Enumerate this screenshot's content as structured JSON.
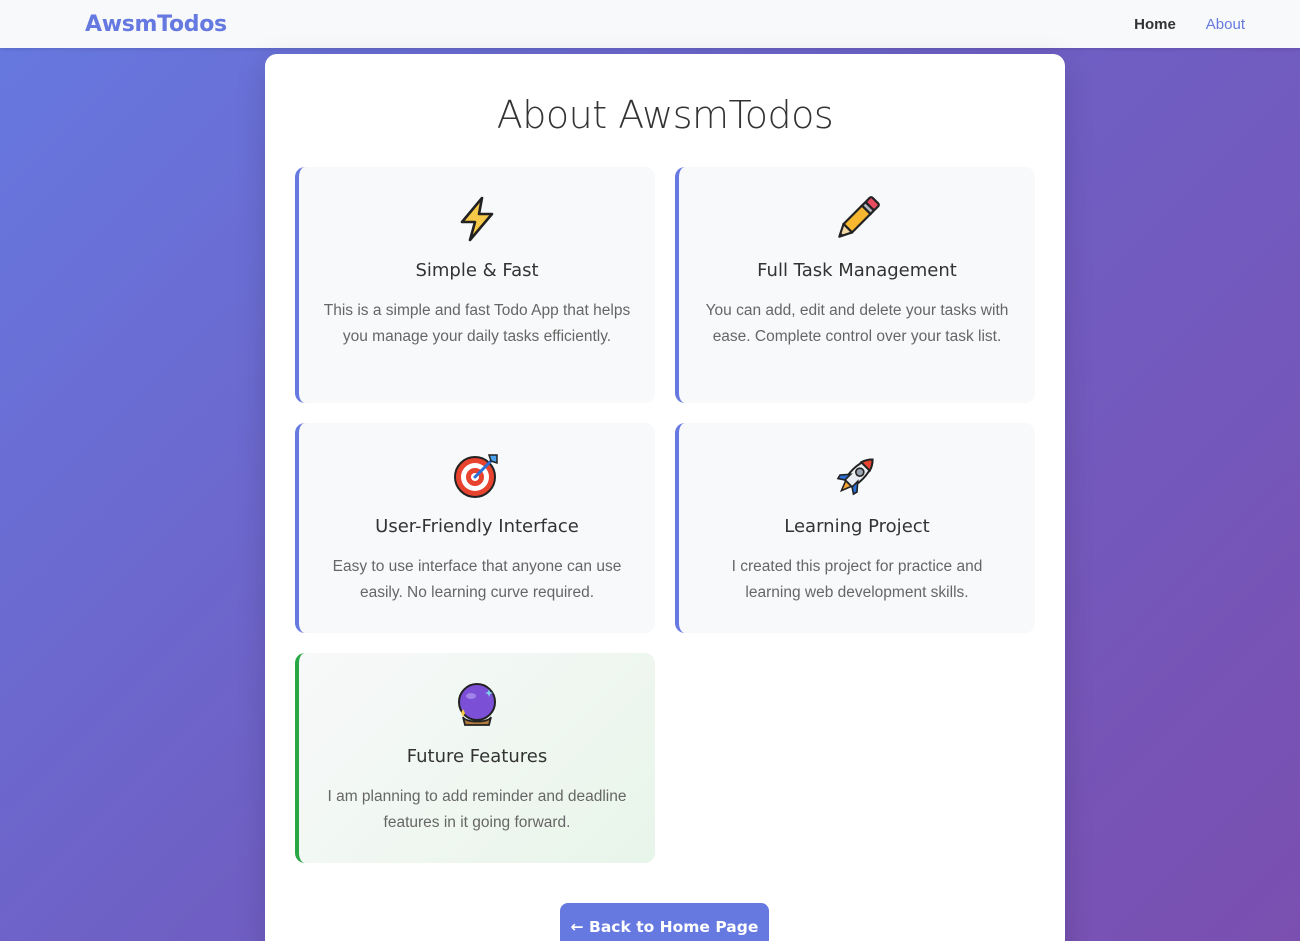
{
  "nav": {
    "brand": "AwsmTodos",
    "links": [
      "Home",
      "About"
    ],
    "active": "About"
  },
  "page": {
    "title": "About AwsmTodos"
  },
  "cards": [
    {
      "icon": "lightning-icon",
      "title": "Simple & Fast",
      "desc": "This is a simple and fast Todo App that helps you manage your daily tasks efficiently."
    },
    {
      "icon": "pencil-icon",
      "title": "Full Task Management",
      "desc": "You can add, edit and delete your tasks with ease. Complete control over your task list."
    },
    {
      "icon": "target-icon",
      "title": "User-Friendly Interface",
      "desc": "Easy to use interface that anyone can use easily. No learning curve required."
    },
    {
      "icon": "rocket-icon",
      "title": "Learning Project",
      "desc": "I created this project for practice and learning web development skills."
    },
    {
      "icon": "crystal-ball-icon",
      "title": "Future Features",
      "desc": "I am planning to add reminder and deadline features in it going forward."
    }
  ],
  "back_button": "← Back to Home Page",
  "colors": {
    "accent": "#6679e0",
    "future_accent": "#28a745",
    "background_start": "#6679e0",
    "background_end": "#7a4fb0"
  }
}
